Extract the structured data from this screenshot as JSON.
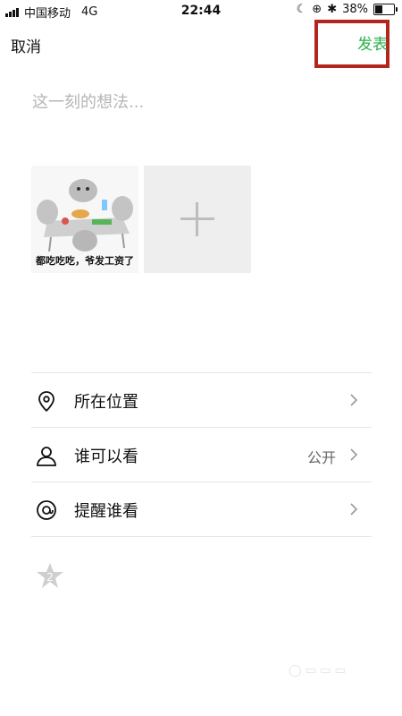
{
  "status_bar": {
    "carrier": "中国移动",
    "network": "4G",
    "time": "22:44",
    "battery_percent_text": "38%",
    "battery_level": 0.38
  },
  "top_bar": {
    "cancel_label": "取消",
    "publish_label": "发表"
  },
  "composer": {
    "placeholder": "这一刻的想法..."
  },
  "media": {
    "image_caption": "都吃吃吃，爷发工资了",
    "add_icon": "plus-icon"
  },
  "options": [
    {
      "icon": "location-pin-icon",
      "label": "所在位置",
      "value": ""
    },
    {
      "icon": "person-icon",
      "label": "谁可以看",
      "value": "公开"
    },
    {
      "icon": "at-icon",
      "label": "提醒谁看",
      "value": ""
    }
  ],
  "footer": {
    "icon": "star-badge-icon"
  },
  "colors": {
    "accent_green": "#2bb14a",
    "highlight_red": "#b3261e",
    "placeholder_gray": "#b5b5b5"
  }
}
